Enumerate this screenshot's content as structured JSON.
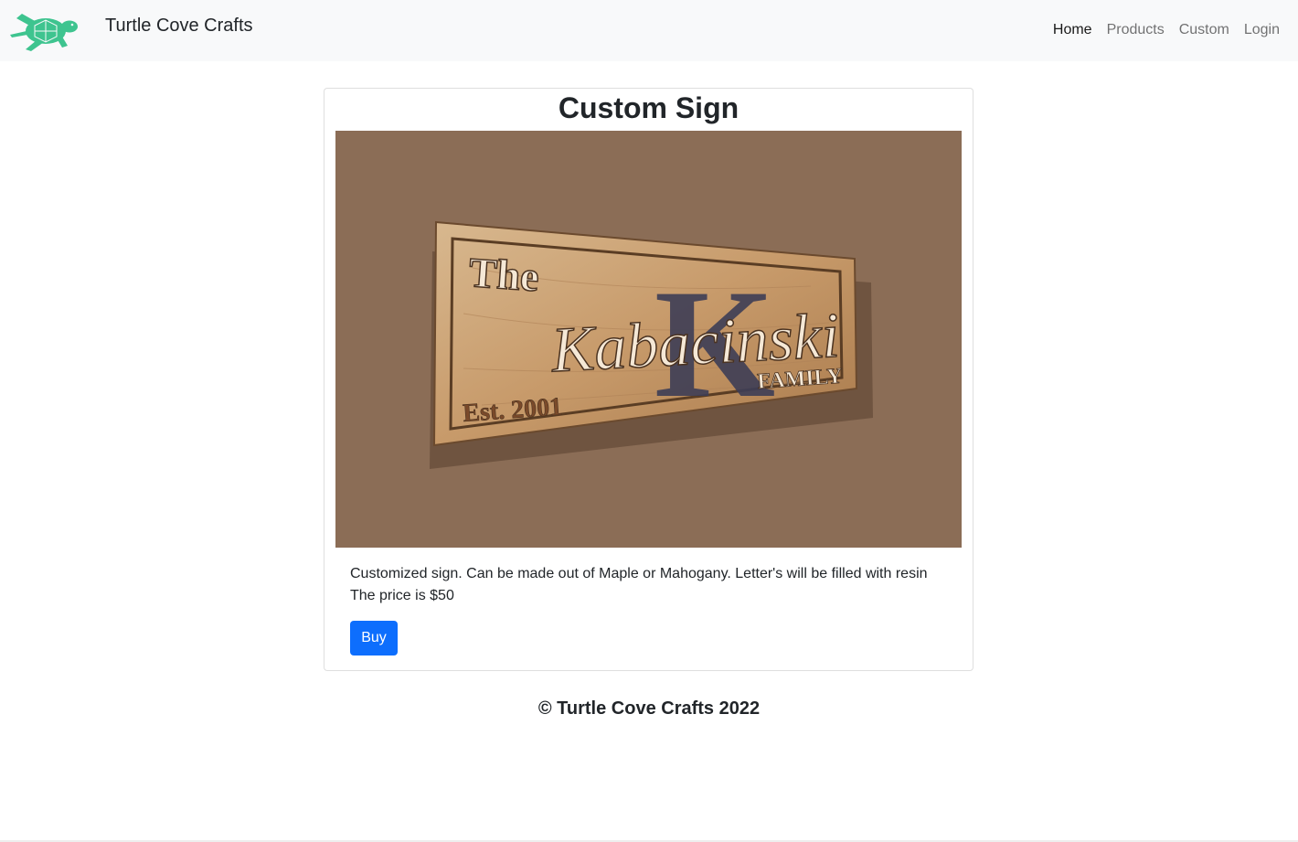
{
  "brand": {
    "name": "Turtle Cove Crafts",
    "logo_icon": "turtle-icon",
    "logo_color": "#3ec48f"
  },
  "nav": {
    "items": [
      {
        "label": "Home",
        "active": true
      },
      {
        "label": "Products",
        "active": false
      },
      {
        "label": "Custom",
        "active": false
      },
      {
        "label": "Login",
        "active": false
      }
    ]
  },
  "product": {
    "title": "Custom Sign",
    "image": {
      "background": "#8b6d56",
      "sign_line_the": "The",
      "sign_initial": "K",
      "sign_name": "Kabacinski",
      "sign_family": "FAMILY",
      "sign_est": "Est. 2001"
    },
    "description": "Customized sign. Can be made out of Maple or Mahogany. Letter's will be filled with resin",
    "price_text": "The price is $50",
    "buy_label": "Buy",
    "buy_color": "#0d6efd"
  },
  "footer": {
    "text": "© Turtle Cove Crafts 2022"
  }
}
